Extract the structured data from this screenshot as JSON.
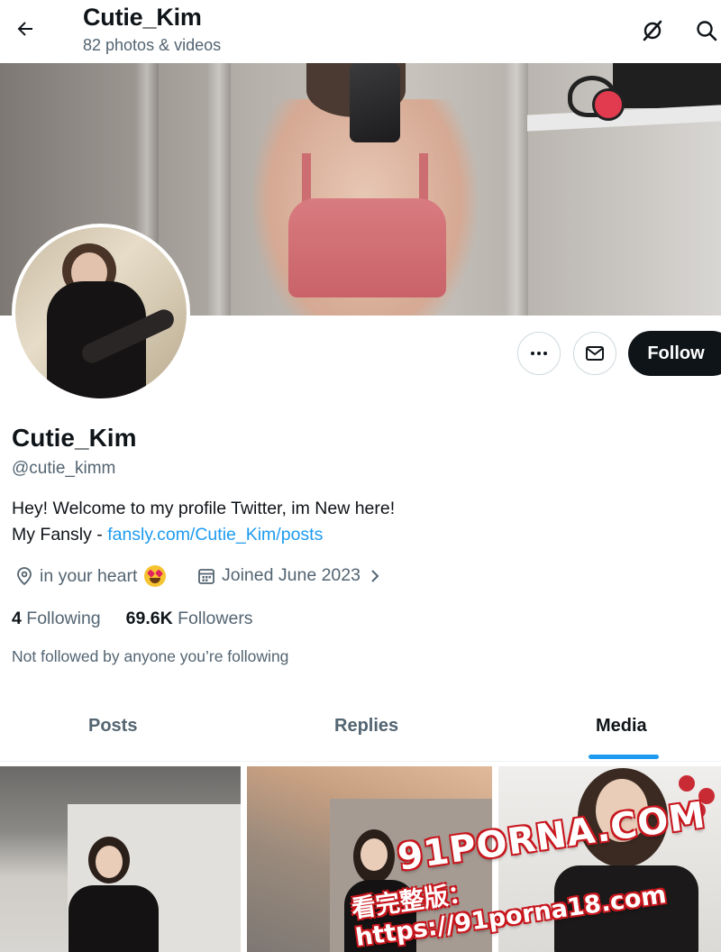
{
  "header": {
    "title": "Cutie_Kim",
    "subtitle": "82 photos & videos"
  },
  "actions": {
    "follow_label": "Follow"
  },
  "profile": {
    "name": "Cutie_Kim",
    "handle": "@cutie_kimm",
    "bio_line1": "Hey! Welcome to my profile Twitter, im New here!",
    "bio_line2_prefix": "My Fansly - ",
    "bio_link": "fansly.com/Cutie_Kim/posts",
    "location": "in your heart",
    "joined": "Joined June 2023",
    "following_count": "4",
    "following_label": "Following",
    "followers_count": "69.6K",
    "followers_label": "Followers",
    "not_followed_note": "Not followed by anyone you’re following"
  },
  "tabs": [
    {
      "label": "Posts",
      "active": false
    },
    {
      "label": "Replies",
      "active": false
    },
    {
      "label": "Media",
      "active": true
    }
  ],
  "watermark": {
    "line1": "91PORNA.COM",
    "line2": "看完整版：https://91porna18.com"
  },
  "colors": {
    "accent": "#1d9bf0",
    "text_primary": "#0f1419",
    "text_secondary": "#536471",
    "follow_button_bg": "#0f1419"
  },
  "icons": {
    "back": "arrow-left-icon",
    "grok": "grok-slash-icon",
    "search": "search-icon",
    "more": "more-horizontal-icon",
    "message": "envelope-icon",
    "location": "location-pin-icon",
    "calendar": "calendar-icon",
    "chevron": "chevron-right-icon",
    "emoji": "heart-eyes-emoji-icon"
  }
}
